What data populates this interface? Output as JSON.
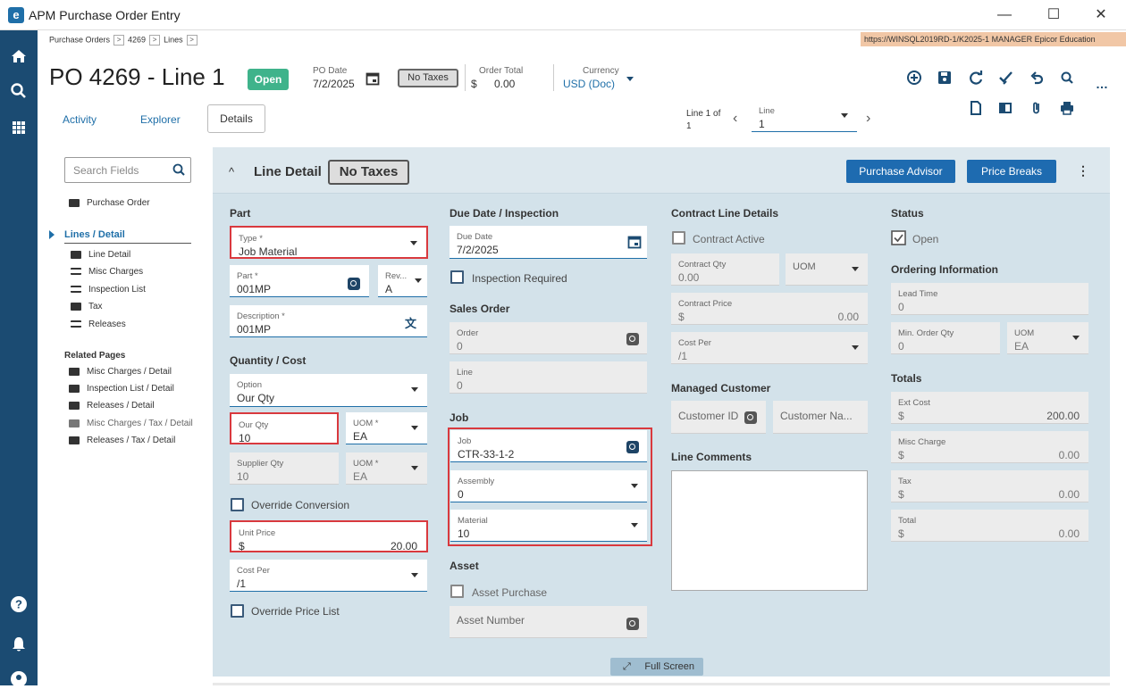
{
  "window": {
    "title": "APM Purchase Order Entry",
    "logo": "e"
  },
  "breadcrumb": {
    "items": [
      "Purchase Orders",
      "4269",
      "Lines"
    ],
    "arrow": ">"
  },
  "url": "https://WINSQL2019RD-1/K2025-1  MANAGER  Epicor Education",
  "header": {
    "title": "PO 4269 - Line 1",
    "status_badge": "Open",
    "po_date_label": "PO Date",
    "po_date": "7/2/2025",
    "no_taxes": "No Taxes",
    "order_total_label": "Order Total",
    "order_total_currency": "$",
    "order_total": "0.00",
    "currency_label": "Currency",
    "currency": "USD (Doc)"
  },
  "tabs": {
    "activity": "Activity",
    "explorer": "Explorer",
    "details": "Details"
  },
  "line_nav": {
    "line_of": "Line 1 of",
    "count": "1",
    "line_label": "Line",
    "line_value": "1"
  },
  "sidebar": {
    "search_placeholder": "Search Fields",
    "purchase_order": "Purchase Order",
    "lines_detail": "Lines / Detail",
    "items": [
      "Line Detail",
      "Misc Charges",
      "Inspection List",
      "Tax",
      "Releases"
    ],
    "related_title": "Related Pages",
    "related": [
      "Misc Charges / Detail",
      "Inspection List / Detail",
      "Releases / Detail",
      "Misc Charges / Tax / Detail",
      "Releases / Tax / Detail"
    ]
  },
  "panel": {
    "title": "Line Detail",
    "no_taxes": "No Taxes",
    "purchase_advisor": "Purchase Advisor",
    "price_breaks": "Price Breaks"
  },
  "part": {
    "heading": "Part",
    "type_label": "Type *",
    "type_value": "Job Material",
    "part_label": "Part *",
    "part_value": "001MP",
    "rev_label": "Rev...",
    "rev_value": "A",
    "desc_label": "Description *",
    "desc_value": "001MP"
  },
  "qty": {
    "heading": "Quantity / Cost",
    "option_label": "Option",
    "option_value": "Our Qty",
    "our_qty_label": "Our Qty",
    "our_qty": "10",
    "uom_label": "UOM *",
    "uom": "EA",
    "supplier_qty_label": "Supplier Qty",
    "supplier_qty": "10",
    "uom2_label": "UOM *",
    "uom2": "EA",
    "override_conversion": "Override Conversion",
    "unit_price_label": "Unit Price",
    "unit_price_currency": "$",
    "unit_price": "20.00",
    "cost_per_label": "Cost Per",
    "cost_per": "/1",
    "override_price_list": "Override Price List"
  },
  "due": {
    "heading": "Due Date / Inspection",
    "due_label": "Due Date",
    "due_value": "7/2/2025",
    "inspection_required": "Inspection Required",
    "sales_order_heading": "Sales Order",
    "order_label": "Order",
    "order_value": "0",
    "line_label": "Line",
    "line_value": "0",
    "job_heading": "Job",
    "job_label": "Job",
    "job_value": "CTR-33-1-2",
    "assembly_label": "Assembly",
    "assembly_value": "0",
    "material_label": "Material",
    "material_value": "10",
    "asset_heading": "Asset",
    "asset_purchase": "Asset Purchase",
    "asset_number": "Asset Number"
  },
  "contract": {
    "heading": "Contract Line Details",
    "contract_active": "Contract Active",
    "qty_label": "Contract Qty",
    "qty_value": "0.00",
    "uom_label": "UOM",
    "price_label": "Contract Price",
    "price_currency": "$",
    "price_value": "0.00",
    "cost_per_label": "Cost Per",
    "cost_per_value": "/1",
    "managed_heading": "Managed Customer",
    "customer_id": "Customer ID",
    "customer_name": "Customer Na...",
    "comments_heading": "Line Comments"
  },
  "status": {
    "heading": "Status",
    "open": "Open",
    "ordering_heading": "Ordering Information",
    "lead_time_label": "Lead Time",
    "lead_time": "0",
    "min_qty_label": "Min. Order Qty",
    "min_qty": "0",
    "uom_label": "UOM",
    "uom": "EA",
    "totals_heading": "Totals",
    "ext_cost_label": "Ext Cost",
    "ext_cost": "200.00",
    "misc_label": "Misc Charge",
    "misc": "0.00",
    "tax_label": "Tax",
    "tax": "0.00",
    "total_label": "Total",
    "total": "0.00",
    "currency": "$"
  },
  "full_screen": "Full Screen",
  "colors": {
    "rail": "#1b4b72",
    "accent": "#1e6bb0",
    "open_badge": "#3fb38b",
    "highlight": "#d9393e",
    "panel": "#d3e2ea"
  }
}
